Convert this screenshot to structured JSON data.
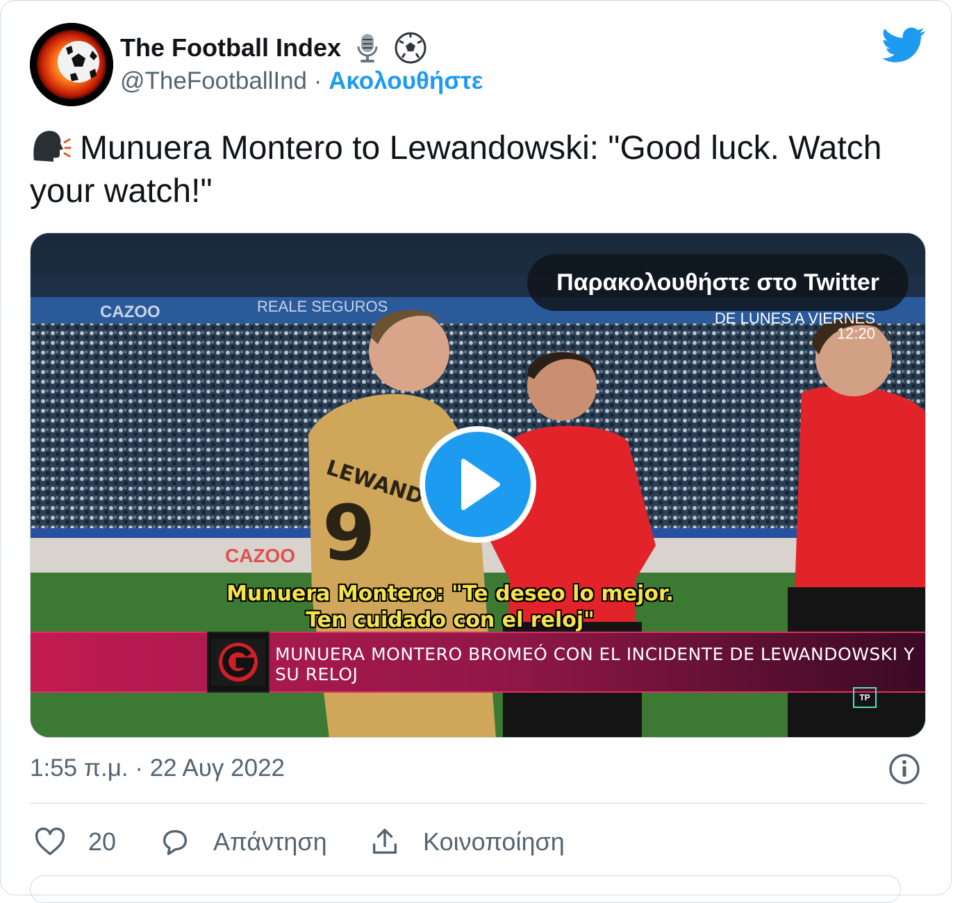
{
  "author": {
    "display_name": "The Football Index",
    "handle": "@TheFootballInd",
    "separator": "·",
    "follow_label": "Ακολουθήστε",
    "name_emojis": [
      "studio-microphone-icon",
      "soccer-ball-icon"
    ]
  },
  "tweet": {
    "emoji": "speaking-head-icon",
    "text": "Munuera Montero to Lewandowski: \"Good luck. Watch your watch!\""
  },
  "media": {
    "watch_label": "Παρακολουθήστε στο Twitter",
    "schedule_line1": "DE LUNES A VIERNES",
    "schedule_line2": "12:20",
    "subtitle_line1": "Munuera Montero: \"Te deseo lo mejor.",
    "subtitle_line2": "Ten cuidado con el reloj\"",
    "news_ticker": "MUNUERA MONTERO BROMEÓ CON EL INCIDENTE DE LEWANDOWSKI Y SU RELOJ",
    "tp_badge": "TP",
    "stadium_ads": [
      "CAZOO",
      "REALE SEGUROS"
    ],
    "player_name": "LEWANDOWSKI",
    "player_number": "9"
  },
  "meta": {
    "timestamp": "1:55 π.μ. · 22 Αυγ 2022"
  },
  "actions": {
    "like_count": "20",
    "reply_label": "Απάντηση",
    "share_label": "Κοινοποίηση"
  },
  "colors": {
    "accent": "#1d9bf0",
    "text_primary": "#0f1419",
    "text_secondary": "#536471",
    "border": "#cfd9de"
  }
}
